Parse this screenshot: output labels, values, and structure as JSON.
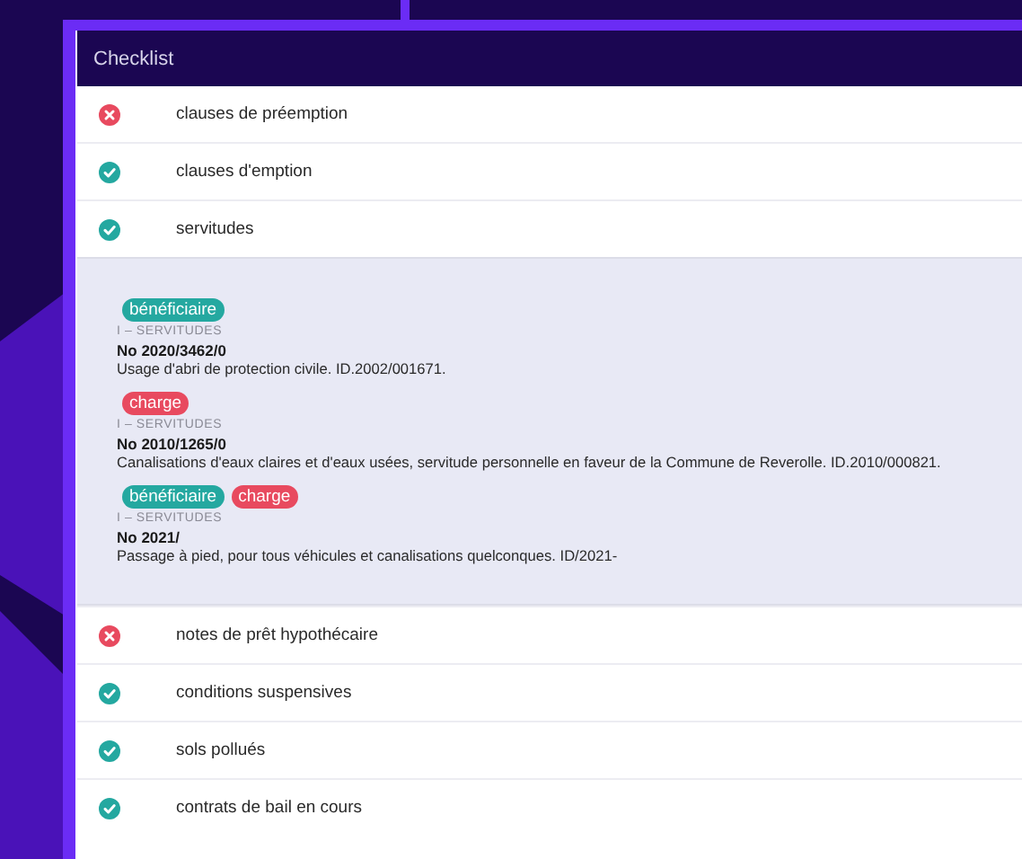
{
  "panel": {
    "title": "Checklist"
  },
  "items": [
    {
      "label": "clauses de préemption",
      "passed": false,
      "expanded": false
    },
    {
      "label": "clauses d'emption",
      "passed": true,
      "expanded": false
    },
    {
      "label": "servitudes",
      "passed": true,
      "expanded": true,
      "entries": [
        {
          "tags": [
            {
              "label": "bénéficiaire",
              "kind": "beneficiary"
            }
          ],
          "section": "I – SERVITUDES",
          "number": "No 2020/3462/0",
          "description": "Usage d'abri de protection civile. ID.2002/001671."
        },
        {
          "tags": [
            {
              "label": "charge",
              "kind": "charge"
            }
          ],
          "section": "I – SERVITUDES",
          "number": "No 2010/1265/0",
          "description": "Canalisations d'eaux claires et d'eaux usées, servitude personnelle en faveur de la Commune de Reverolle. ID.2010/000821."
        },
        {
          "tags": [
            {
              "label": "bénéficiaire",
              "kind": "beneficiary"
            },
            {
              "label": "charge",
              "kind": "charge"
            }
          ],
          "section": "I – SERVITUDES",
          "number": "No 2021/",
          "description": "Passage à pied, pour tous véhicules et canalisations quelconques. ID/2021-"
        }
      ]
    },
    {
      "label": "notes de prêt hypothécaire",
      "passed": false,
      "expanded": false
    },
    {
      "label": "conditions suspensives",
      "passed": true,
      "expanded": false
    },
    {
      "label": "sols pollués",
      "passed": true,
      "expanded": false
    },
    {
      "label": "contrats de bail en cours",
      "passed": true,
      "expanded": false
    }
  ]
}
